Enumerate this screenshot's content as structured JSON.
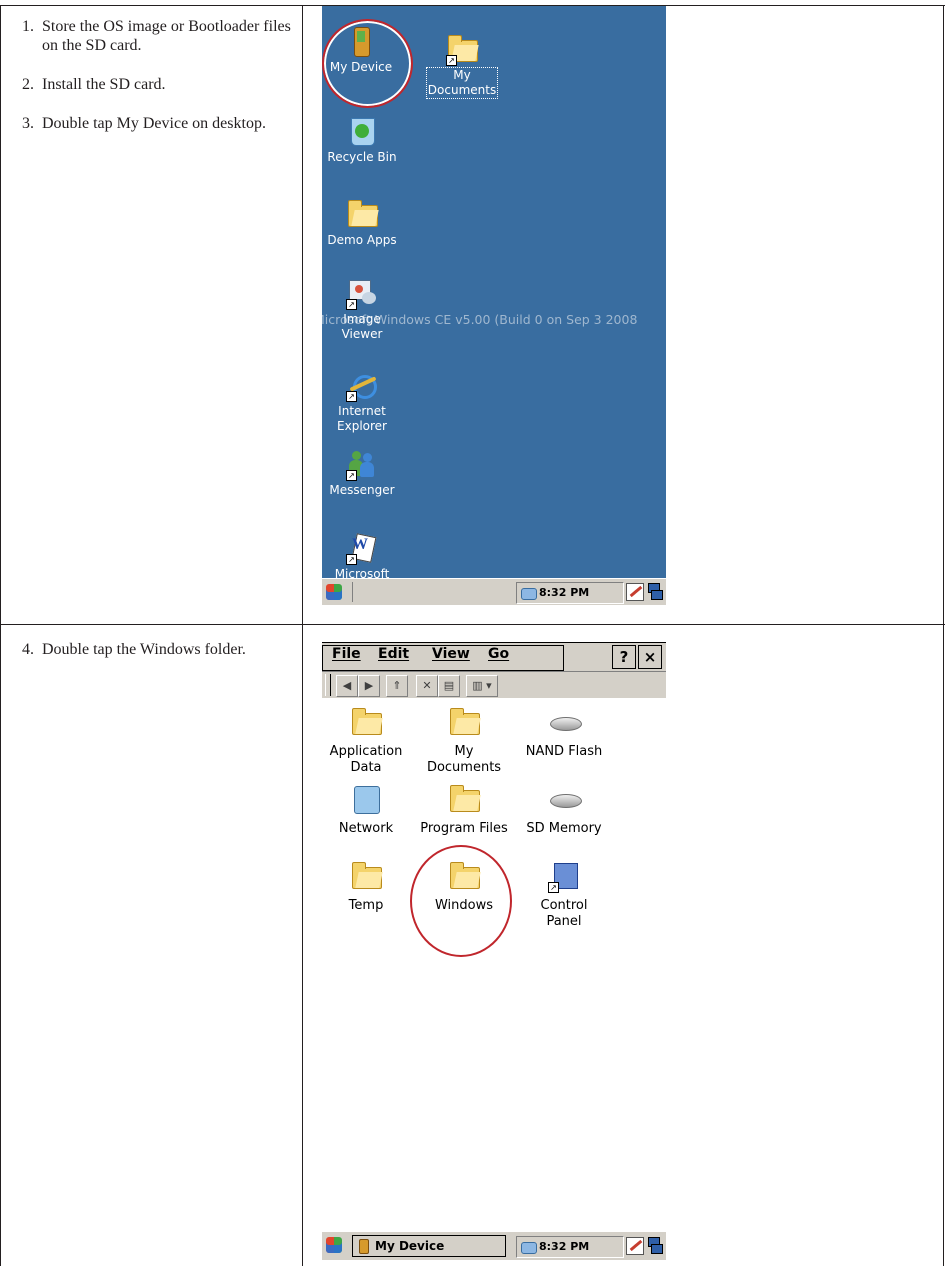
{
  "steps_top": [
    {
      "num": "1.",
      "text": "Store the OS image or Bootloader files on the SD card."
    },
    {
      "num": "2.",
      "text": "Install the SD card."
    },
    {
      "num": "3.",
      "text": "Double tap My Device on desktop."
    }
  ],
  "steps_bottom": [
    {
      "num": "4.",
      "text": "Double tap the Windows folder."
    }
  ],
  "desktop": {
    "background_color": "#396da0",
    "watermark": "Microsoft Windows CE v5.00 (Build 0 on Sep  3 2008",
    "icons": {
      "my_device": "My Device",
      "my_documents": "My Documents",
      "recycle_bin": "Recycle Bin",
      "demo_apps": "Demo Apps",
      "image_viewer": "Image Viewer",
      "internet_explorer": "Internet Explorer",
      "messenger": "Messenger",
      "microsoft": "Microsoft"
    },
    "taskbar": {
      "time": "8:32 PM"
    }
  },
  "explorer": {
    "menu": {
      "file": "File",
      "edit": "Edit",
      "view": "View",
      "go": "Go",
      "help": "?",
      "close": "×"
    },
    "items": {
      "application_data": "Application Data",
      "my_documents": "My Documents",
      "nand_flash": "NAND Flash",
      "network": "Network",
      "program_files": "Program Files",
      "sd_memory": "SD Memory",
      "temp": "Temp",
      "windows": "Windows",
      "control_panel": "Control Panel"
    },
    "taskbar": {
      "window_button": "My Device",
      "time": "8:32 PM"
    }
  },
  "colors": {
    "highlight_ring": "#c0262c",
    "desktop_blue": "#396da0",
    "chrome_gray": "#d4d0c8"
  }
}
